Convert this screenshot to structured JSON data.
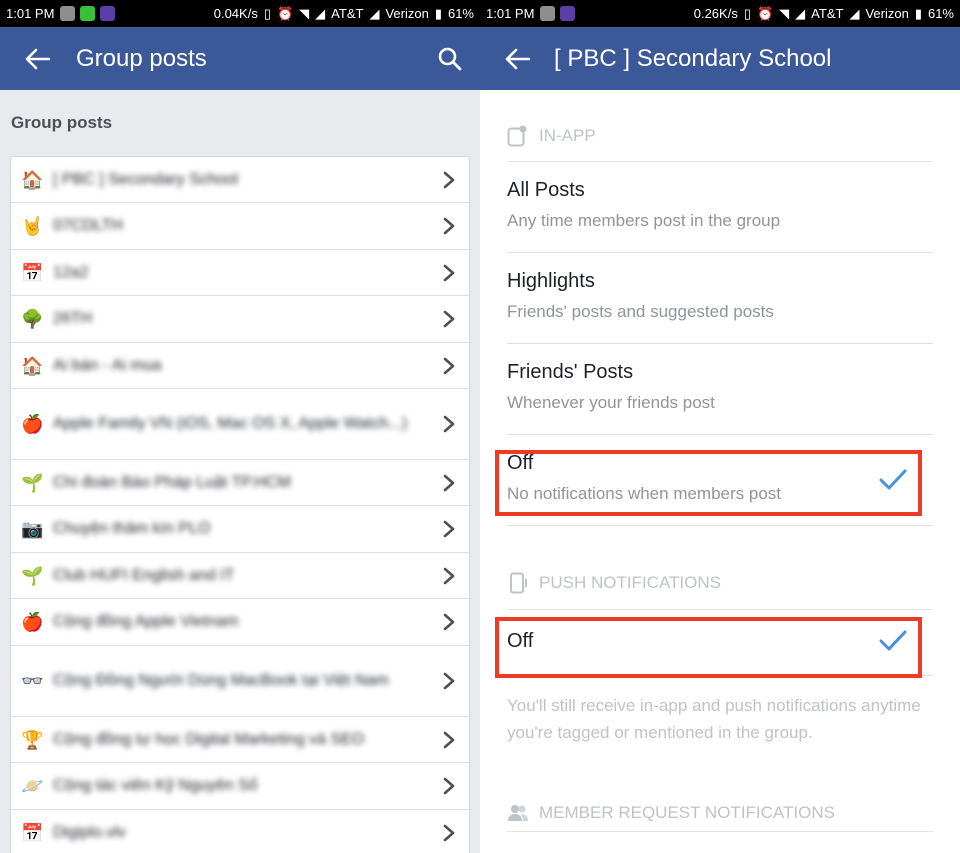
{
  "left": {
    "status": {
      "time": "1:01 PM",
      "speed": "0.04K/s",
      "carrier1": "AT&T",
      "carrier2": "Verizon",
      "battery": "61%"
    },
    "title": "Group posts",
    "section_title": "Group posts",
    "groups": [
      {
        "name": "[ PBC ] Secondary School",
        "icon": "house-icon"
      },
      {
        "name": "07CDLTH",
        "icon": "rock-hand-icon"
      },
      {
        "name": "12a2",
        "icon": "calendar-group-icon"
      },
      {
        "name": "26TH",
        "icon": "tree-icon"
      },
      {
        "name": "Ai bán - Ai mua",
        "icon": "house-icon"
      },
      {
        "name": "Apple Family VN (iOS, Mac OS X, Apple Watch...)",
        "icon": "apple-icon"
      },
      {
        "name": "Chi đoàn Báo Pháp Luật TP.HCM",
        "icon": "sprout-icon"
      },
      {
        "name": "Chuyện thâm kín PLO",
        "icon": "camera-icon"
      },
      {
        "name": "Club HUFI English and IT",
        "icon": "sprout-icon"
      },
      {
        "name": "Cộng đồng Apple Vietnam",
        "icon": "apple-icon"
      },
      {
        "name": "Cộng Đồng Người Dùng MacBook tại Việt Nam",
        "icon": "glasses-icon"
      },
      {
        "name": "Cộng đồng tự học Digital Marketing và SEO",
        "icon": "trophy-icon"
      },
      {
        "name": "Cộng tác viên Kỹ Nguyên Số",
        "icon": "planet-icon"
      },
      {
        "name": "Digiplo.vlv",
        "icon": "calendar-group-icon"
      }
    ]
  },
  "right": {
    "status": {
      "time": "1:01 PM",
      "speed": "0.26K/s",
      "carrier1": "AT&T",
      "carrier2": "Verizon",
      "battery": "61%"
    },
    "title": "[ PBC ] Secondary School",
    "in_app_header": "IN-APP",
    "options": [
      {
        "title": "All Posts",
        "desc": "Any time members post in the group",
        "selected": false
      },
      {
        "title": "Highlights",
        "desc": "Friends' posts and suggested posts",
        "selected": false
      },
      {
        "title": "Friends' Posts",
        "desc": "Whenever your friends post",
        "selected": false
      },
      {
        "title": "Off",
        "desc": "No notifications when members post",
        "selected": true
      }
    ],
    "push_header": "PUSH NOTIFICATIONS",
    "push_option": {
      "title": "Off",
      "selected": true
    },
    "push_note": "You'll still receive in-app and push notifications anytime you're tagged or mentioned in the group.",
    "member_header": "MEMBER REQUEST NOTIFICATIONS"
  },
  "colors": {
    "header": "#3b5998",
    "check": "#4a90e2",
    "highlight": "#ee3b24"
  }
}
